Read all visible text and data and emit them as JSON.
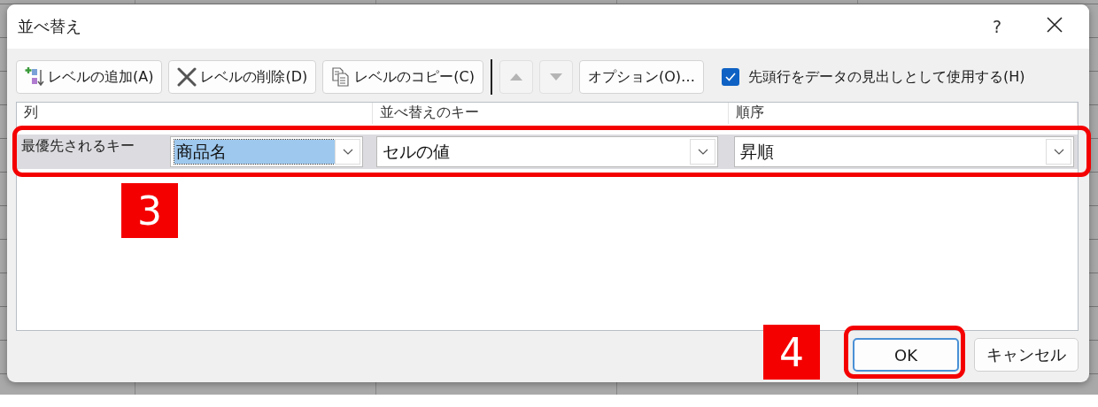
{
  "window": {
    "title": "並べ替え",
    "help": "?"
  },
  "toolbar": {
    "buttons": [
      {
        "kind": "add",
        "label": "レベルの追加(A)",
        "disabled": false
      },
      {
        "kind": "delete",
        "label": "レベルの削除(D)",
        "disabled": false
      },
      {
        "kind": "copy",
        "label": "レベルのコピー(C)",
        "disabled": false
      },
      {
        "kind": "up",
        "disabled": true
      },
      {
        "kind": "down",
        "disabled": true
      },
      {
        "kind": "options",
        "label": "オプション(O)…",
        "disabled": false
      }
    ]
  },
  "header_checkbox": {
    "label": "先頭行をデータの見出しとして使用する(H)",
    "checked": true
  },
  "table": {
    "columns": [
      "列",
      "並べ替えのキー",
      "順序"
    ],
    "rows": [
      {
        "level_label": "最優先されるキー",
        "selected": true,
        "column": {
          "value": "商品名",
          "highlighted": true
        },
        "sort_on": "セルの値",
        "order": "昇順"
      }
    ]
  },
  "annotations": [
    {
      "kind": "row_frame",
      "step": "3"
    },
    {
      "kind": "button_frame",
      "step": "4"
    }
  ],
  "buttons": [
    {
      "label": "OK",
      "default": true
    },
    {
      "label": "キャンセル",
      "default": false
    }
  ]
}
